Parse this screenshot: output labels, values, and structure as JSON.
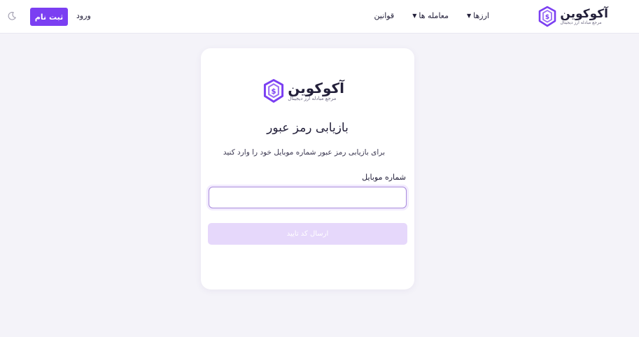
{
  "brand": {
    "name": "آکوکوین",
    "tagline": "مرجع مبادله ارز دیجیتال",
    "accent_color": "#7b3ff2"
  },
  "header": {
    "nav": [
      {
        "label": "ارزها",
        "has_dropdown": true
      },
      {
        "label": "معامله ها",
        "has_dropdown": true
      },
      {
        "label": "قوانین",
        "has_dropdown": false
      }
    ],
    "login_label": "ورود",
    "signup_label": "ثبت نام",
    "theme_icon": "moon-icon"
  },
  "card": {
    "title": "بازیابی رمز عبور",
    "description": "برای بازیابی رمز عبور شماره موبایل خود را وارد کنید",
    "phone_label": "شماره موبایل",
    "phone_value": "",
    "submit_label": "ارسال کد تایید",
    "submit_disabled": true
  }
}
